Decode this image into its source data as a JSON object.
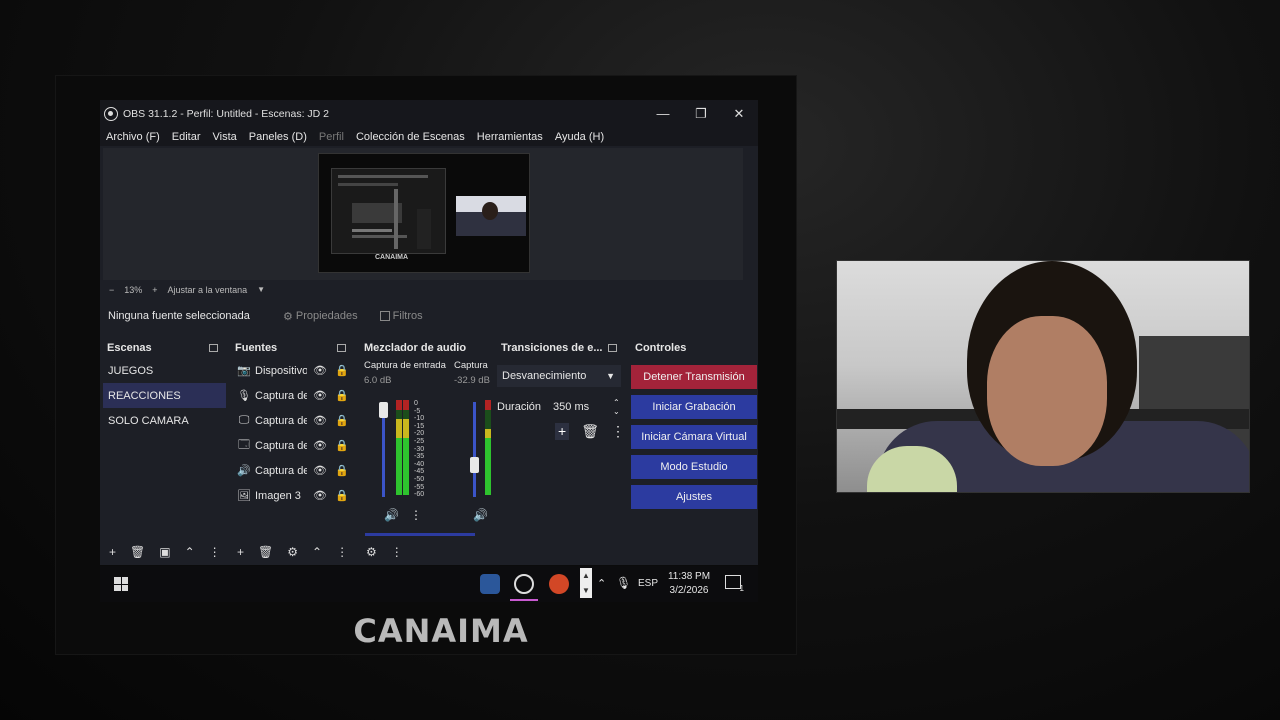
{
  "window": {
    "title": "OBS 31.1.2 - Perfil: Untitled - Escenas: JD 2",
    "controls": [
      "—",
      "❐",
      "✕"
    ]
  },
  "menu": [
    "Archivo (F)",
    "Editar",
    "Vista",
    "Paneles (D)",
    "Perfil",
    "Colección de Escenas",
    "Herramientas",
    "Ayuda (H)"
  ],
  "preview": {
    "mini_label": "CANAIMA",
    "zoom_minus": "−",
    "zoom_value": "13%",
    "zoom_plus": "+",
    "fit_label": "Ajustar a la ventana",
    "fit_arrow": "▼"
  },
  "source_bar": {
    "none_selected": "Ninguna fuente seleccionada",
    "properties": "Propiedades",
    "filters": "Filtros"
  },
  "scenes": {
    "title": "Escenas",
    "items": [
      "JUEGOS",
      "REACCIONES",
      "SOLO CAMARA"
    ],
    "selected": "REACCIONES"
  },
  "sources": {
    "title": "Fuentes",
    "items": [
      {
        "icon": "camera-icon",
        "label": "Dispositivo"
      },
      {
        "icon": "microphone-icon",
        "label": "Captura de"
      },
      {
        "icon": "monitor-icon",
        "label": "Captura de"
      },
      {
        "icon": "window-icon",
        "label": "Captura de"
      },
      {
        "icon": "speaker-icon",
        "label": "Captura de"
      },
      {
        "icon": "image-icon",
        "label": "Imagen 3"
      }
    ]
  },
  "mixer": {
    "title": "Mezclador de audio",
    "ch1_name": "Captura de entrada",
    "ch1_db": "6.0 dB",
    "ch1_level": 0.8,
    "ch2_name": "Captura de",
    "ch2_db": "-32.9 dB",
    "ch2_level": 0.7,
    "scale": [
      "0",
      "-5",
      "-10",
      "-15",
      "-20",
      "-25",
      "-30",
      "-35",
      "-40",
      "-45",
      "-50",
      "-55",
      "-60"
    ]
  },
  "transitions": {
    "title": "Transiciones de e...",
    "type": "Desvanecimiento",
    "duration_label": "Duración",
    "duration_value": "350 ms"
  },
  "controls": {
    "title": "Controles",
    "buttons": [
      "Detener Transmisión",
      "Iniciar Grabación",
      "Iniciar Cámara Virtual",
      "Modo Estudio",
      "Ajustes"
    ]
  },
  "taskbar": {
    "language": "ESP",
    "time": "11:38 PM",
    "date": "3/2/2026",
    "notifications": "1"
  },
  "overlay_logo": "CANAIMA",
  "colors": {
    "accent_blue": "#2c3ba0",
    "stop_red": "#a3233a",
    "panel_bg": "#1d1f26"
  }
}
